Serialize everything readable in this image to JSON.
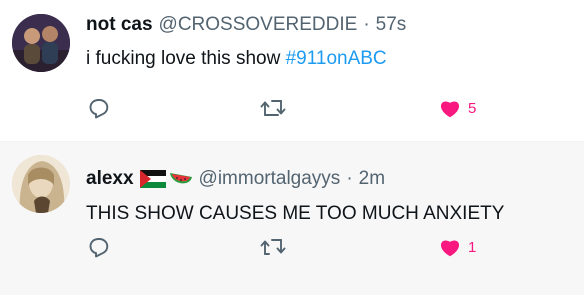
{
  "tweets": [
    {
      "display_name": "not cas",
      "handle": "@CROSSOVEREDDIE",
      "separator": "·",
      "time": "57s",
      "text_prefix": "i fucking love this show ",
      "hashtag": "#911onABC",
      "likes": "5",
      "liked": true,
      "icons": [
        "reply-icon",
        "retweet-icon",
        "heart-filled-icon"
      ]
    },
    {
      "display_name": "alexx",
      "flags": [
        "palestine-flag",
        "watermelon"
      ],
      "handle": "@immortalgayys",
      "separator": "·",
      "time": "2m",
      "text": "THIS SHOW CAUSES ME TOO MUCH ANXIETY",
      "likes": "1",
      "liked": true,
      "icons": [
        "reply-icon",
        "retweet-icon",
        "heart-filled-icon"
      ]
    }
  ],
  "colors": {
    "accent_blue": "#1d9bf0",
    "like_pink": "#f91880",
    "muted": "#536471",
    "text": "#0f1419"
  }
}
